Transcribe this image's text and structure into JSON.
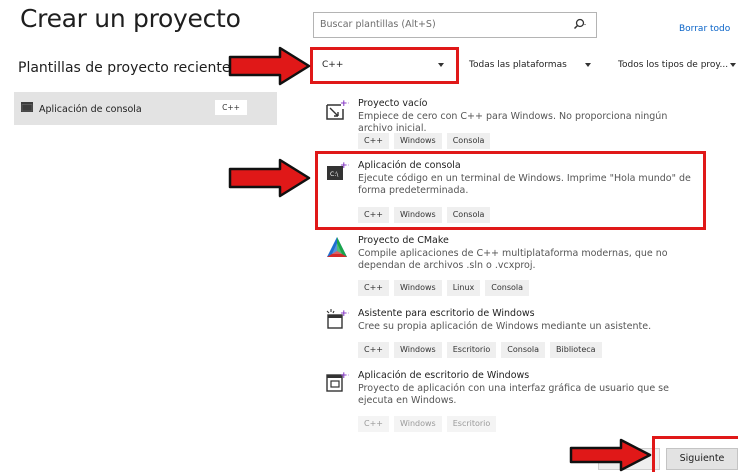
{
  "header": {
    "title": "Crear un proyecto",
    "recent_heading": "Plantillas de proyecto recientes"
  },
  "search": {
    "placeholder": "Buscar plantillas (Alt+S)",
    "clear_all": "Borrar todo"
  },
  "filters": {
    "language": "C++",
    "platform": "Todas las plataformas",
    "project_type": "Todos los tipos de proy..."
  },
  "recent": {
    "item_label": "Aplicación de consola",
    "item_lang": "C++"
  },
  "templates": [
    {
      "title": "Proyecto vacío",
      "description": "Empiece de cero con C++ para Windows. No proporciona ningún archivo inicial.",
      "tags": [
        "C++",
        "Windows",
        "Consola"
      ]
    },
    {
      "title": "Aplicación de consola",
      "description": "Ejecute código en un terminal de Windows. Imprime \"Hola mundo\" de forma predeterminada.",
      "tags": [
        "C++",
        "Windows",
        "Consola"
      ]
    },
    {
      "title": "Proyecto de CMake",
      "description": "Compile aplicaciones de C++ multiplataforma modernas, que no dependan de archivos .sln o .vcxproj.",
      "tags": [
        "C++",
        "Windows",
        "Linux",
        "Consola"
      ]
    },
    {
      "title": "Asistente para escritorio de Windows",
      "description": "Cree su propia aplicación de Windows mediante un asistente.",
      "tags": [
        "C++",
        "Windows",
        "Escritorio",
        "Consola",
        "Biblioteca"
      ]
    },
    {
      "title": "Aplicación de escritorio de Windows",
      "description": "Proyecto de aplicación con una interfaz gráfica de usuario que se ejecuta en Windows.",
      "tags": [
        "C++",
        "Windows",
        "Escritorio"
      ]
    }
  ],
  "footer": {
    "next_label": "Siguiente"
  },
  "colors": {
    "annotation_red": "#e01818",
    "link_blue": "#0a64c8",
    "panel_gray": "#e3e3e3"
  }
}
